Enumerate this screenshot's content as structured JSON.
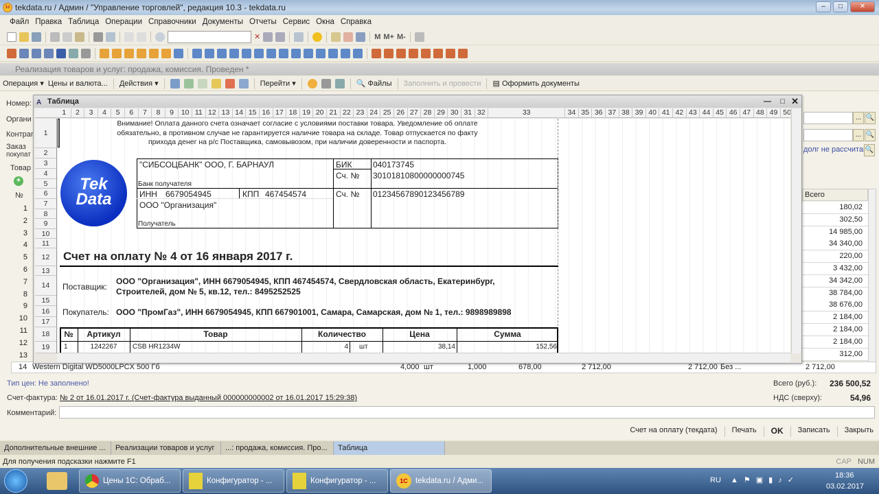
{
  "window": {
    "title": "tekdata.ru / Админ / \"Управление торговлей\", редакция 10.3 - tekdata.ru"
  },
  "menu": [
    "Файл",
    "Правка",
    "Таблица",
    "Операции",
    "Справочники",
    "Документы",
    "Отчеты",
    "Сервис",
    "Окна",
    "Справка"
  ],
  "toolbar1": {
    "memory_buttons": [
      "M",
      "M+",
      "M-"
    ]
  },
  "toolbar2_icons": [
    "report-icon",
    "document-icon",
    "document-icon",
    "document-icon",
    "users-icon",
    "calculator-icon",
    "edit-icon",
    "catalog-icon",
    "catalog-icon",
    "catalog-icon",
    "catalog-icon",
    "catalog-icon",
    "catalog-icon",
    "doc-icon",
    "doc-icon",
    "doc-icon",
    "doc-icon",
    "doc-icon",
    "doc-icon",
    "doc-icon",
    "doc-icon",
    "doc-icon",
    "doc-icon",
    "doc-icon",
    "doc-icon",
    "doc-icon",
    "doc-icon",
    "doc-icon",
    "report-icon",
    "report-icon",
    "report-icon",
    "report-icon",
    "report-icon",
    "report-icon",
    "report-icon",
    "report-icon"
  ],
  "doc_window": {
    "title": "Реализация товаров и услуг: продажа, комиссия. Проведен *",
    "toolbar": {
      "operation": "Операция",
      "prices": "Цены и валюта...",
      "actions": "Действия",
      "go": "Перейти",
      "files": "Файлы",
      "fill_post": "Заполнить и провести",
      "make_docs": "Оформить документы"
    },
    "labels": {
      "number": "Номер:",
      "org": "Органи",
      "contr": "Контраг",
      "order1": "Заказ",
      "order2": "покупат",
      "goods_tab": "Товар",
      "debt": "долг не рассчитан",
      "col_n": "№",
      "col_total": "Всего"
    },
    "row_numbers": [
      "1",
      "2",
      "3",
      "4",
      "5",
      "6",
      "7",
      "8",
      "9",
      "10",
      "11",
      "12",
      "13",
      "14"
    ],
    "totals_column": [
      "180,02",
      "302,50",
      "14 985,00",
      "34 340,00",
      "220,00",
      "3 432,00",
      "34 342,00",
      "38 784,00",
      "38 676,00",
      "2 184,00",
      "2 184,00",
      "2 184,00",
      "312,00",
      "2 712,00"
    ],
    "row14": {
      "n": "14",
      "name": "Western Digital WD5000LPCX 500 Гб",
      "qty": "4,000",
      "unit": "шт",
      "k": "1,000",
      "price": "678,00",
      "sum": "2 712,00",
      "sum2": "2 712,00",
      "vat": "Без ..."
    },
    "price_type": "Тип цен: Не заполнено!",
    "invoice_label": "Счет-фактура:",
    "invoice_link": "№ 2 от 16.01.2017 г. (Счет-фактура выданный 000000000002 от 16.01.2017 15:29:38)",
    "comment_label": "Комментарий:",
    "comment_value": "",
    "total_label": "Всего (руб.):",
    "total_value": "236 500,52",
    "vat_label": "НДС (сверху):",
    "vat_value": "54,96",
    "buttons": {
      "invoice": "Счет на оплату (текдата)",
      "print": "Печать",
      "ok": "OK",
      "save": "Записать",
      "close": "Закрыть"
    }
  },
  "table_window": {
    "title": "Таблица",
    "columns": [
      "1",
      "2",
      "3",
      "4",
      "5",
      "6",
      "7",
      "8",
      "9",
      "10",
      "11",
      "12",
      "13",
      "14",
      "15",
      "16",
      "17",
      "18",
      "19",
      "20",
      "21",
      "22",
      "23",
      "24",
      "25",
      "26",
      "27",
      "28",
      "29",
      "30",
      "31",
      "32",
      "33",
      "34",
      "35",
      "36",
      "37",
      "38",
      "39",
      "40",
      "41",
      "42",
      "43",
      "44",
      "45",
      "46",
      "47",
      "48",
      "49",
      "50"
    ],
    "rows": [
      "1",
      "2",
      "3",
      "4",
      "5",
      "6",
      "7",
      "8",
      "9",
      "10",
      "11",
      "12",
      "13",
      "14",
      "15",
      "16",
      "17",
      "18",
      "19"
    ]
  },
  "invoice": {
    "notice": [
      "Внимание! Оплата данного счета означает согласие с условиями поставки товара. Уведомление об оплате",
      "обязательно, в противном случае не гарантируется наличие товара на складе. Товар отпускается по факту",
      "прихода денег на р/с Поставщика, самовывозом, при наличии доверенности и паспорта."
    ],
    "logo_text": [
      "Tek",
      "Data"
    ],
    "bank_name": "\"СИБСОЦБАНК\" ООО, Г. БАРНАУЛ",
    "bank_label": "Банк получателя",
    "bik_label": "БИК",
    "bik": "040173745",
    "acc_label": "Сч. №",
    "corr_acc": "30101810800000000745",
    "inn_label": "ИНН",
    "inn": "6679054945",
    "kpp_label": "КПП",
    "kpp": "467454574",
    "recipient": "ООО \"Организация\"",
    "recipient_label": "Получатель",
    "acc2_label": "Сч. №",
    "account": "01234567890123456789",
    "title": "Счет на оплату № 4 от 16 января 2017 г.",
    "supplier_label": "Поставщик:",
    "supplier": [
      "ООО \"Организация\", ИНН 6679054945, КПП 467454574, Свердловская область, Екатеринбург,",
      "Строителей, дом № 5, кв.12, тел.: 8495252525"
    ],
    "buyer_label": "Покупатель:",
    "buyer": "ООО \"ПромГаз\", ИНН 6679054945, КПП 667901001, Самара, Самарская, дом № 1, тел.: 9898989898",
    "headers": [
      "№",
      "Артикул",
      "Товар",
      "Количество",
      "Цена",
      "Сумма"
    ],
    "items": [
      {
        "n": "1",
        "article": "1242267",
        "name": "CSB HR1234W",
        "qty": "4",
        "unit": "шт",
        "price": "38,14",
        "sum": "152,56"
      }
    ]
  },
  "window_tabs": [
    "Дополнительные внешние ...",
    "Реализации товаров и услуг",
    "...: продажа, комиссия. Про...",
    "Таблица"
  ],
  "status": {
    "hint": "Для получения подсказки нажмите F1",
    "cap": "CAP",
    "num": "NUM"
  },
  "taskbar": {
    "items": [
      "Цены 1С: Обраб...",
      "Конфигуратор - ...",
      "Конфигуратор - ...",
      "tekdata.ru / Адми..."
    ],
    "lang": "RU",
    "time": "18:36",
    "date": "03.02.2017"
  }
}
